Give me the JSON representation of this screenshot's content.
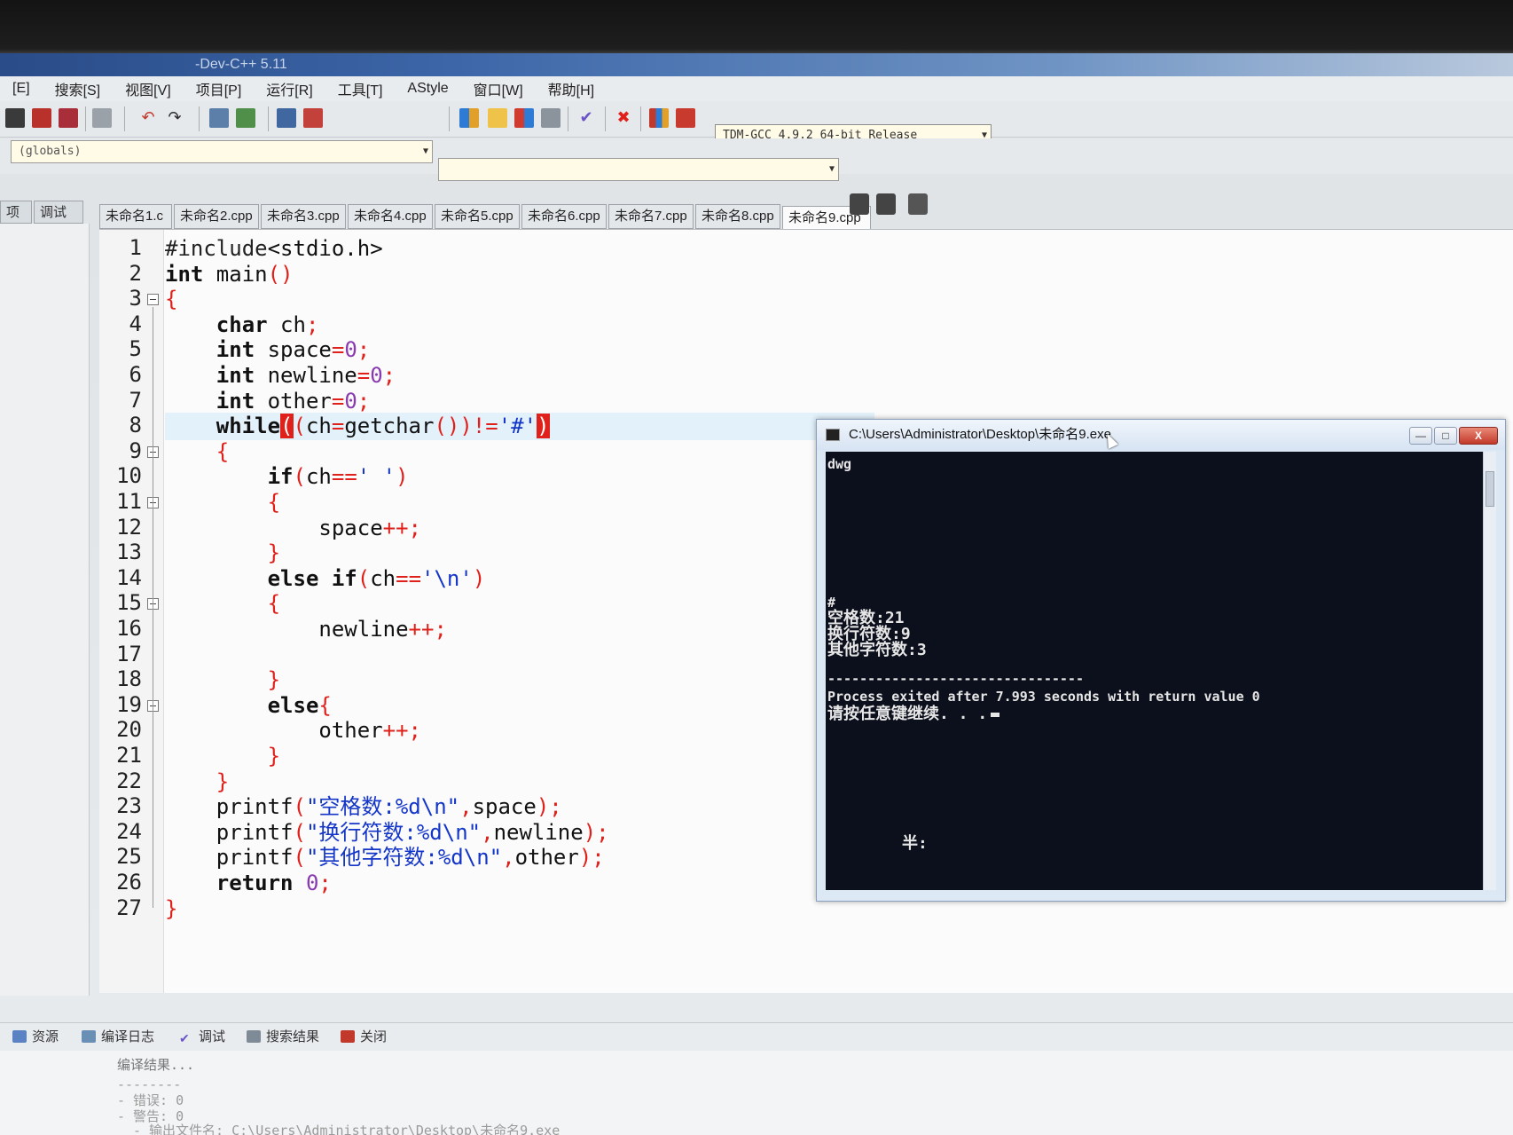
{
  "window": {
    "title": "-Dev-C++ 5.11"
  },
  "menu": [
    "[E]",
    "搜索[S]",
    "视图[V]",
    "项目[P]",
    "运行[R]",
    "工具[T]",
    "AStyle",
    "窗口[W]",
    "帮助[H]"
  ],
  "toolbar": {
    "compiler": "TDM-GCC 4.9.2 64-bit Release",
    "icons": [
      "new-file-icon",
      "open-icon",
      "save-icon",
      "print-icon",
      "undo-icon",
      "redo-icon",
      "find-icon",
      "replace-icon",
      "indent-icon",
      "unindent-icon",
      "compile-icon",
      "run-icon",
      "compile-run-icon",
      "rebuild-icon",
      "check-icon",
      "stop-icon",
      "chart-icon",
      "debug-icon"
    ]
  },
  "scope": {
    "left_combo": "(globals)",
    "right_combo": ""
  },
  "left_panel": {
    "tabs": [
      "项目",
      "调试"
    ]
  },
  "editor": {
    "tabs": [
      "未命名1.c",
      "未命名2.cpp",
      "未命名3.cpp",
      "未命名4.cpp",
      "未命名5.cpp",
      "未命名6.cpp",
      "未命名7.cpp",
      "未命名8.cpp",
      "未命名9.cpp"
    ],
    "active_tab": 8,
    "highlight_line": 8,
    "lines": [
      "#include<stdio.h>",
      "int main()",
      "{",
      "    char ch;",
      "    int space=0;",
      "    int newline=0;",
      "    int other=0;",
      "    while((ch=getchar())!='#')",
      "    {",
      "        if(ch==' ')",
      "        {",
      "            space++;",
      "        }",
      "        else if(ch=='\\n')",
      "        {",
      "            newline++;",
      "",
      "        }",
      "        else{",
      "            other++;",
      "        }",
      "    }",
      "    printf(\"空格数:%d\\n\",space);",
      "    printf(\"换行符数:%d\\n\",newline);",
      "    printf(\"其他字符数:%d\\n\",other);",
      "    return 0;",
      "}"
    ]
  },
  "console": {
    "title": "C:\\Users\\Administrator\\Desktop\\未命名9.exe",
    "buttons": {
      "minimize": "—",
      "maximize": "□",
      "close": "X"
    },
    "lines": [
      {
        "text": "dwg"
      },
      {
        "text": "#"
      },
      {
        "text": "空格数:21"
      },
      {
        "text": "换行符数:9"
      },
      {
        "text": "其他字符数:3"
      },
      {
        "text": "--------------------------------"
      },
      {
        "text": "Process exited after 7.993 seconds with return value 0"
      },
      {
        "text": "请按任意键继续. . ."
      }
    ],
    "ime": "半:"
  },
  "bottom": {
    "tabs": [
      "资源",
      "编译日志",
      "调试",
      "搜索结果",
      "关闭"
    ],
    "log": [
      "编译结果...",
      "--------",
      "- 错误: 0",
      "- 警告: 0",
      "- 输出文件名: C:\\Users\\Administrator\\Desktop\\未命名9.exe"
    ]
  }
}
